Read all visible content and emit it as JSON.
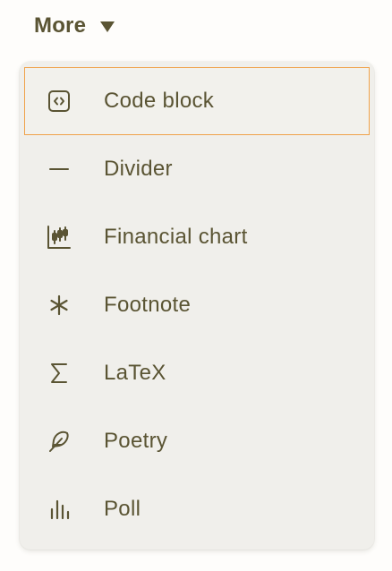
{
  "toggle": {
    "label": "More"
  },
  "menu": {
    "items": [
      {
        "label": "Code block",
        "icon": "code-block-icon",
        "active": true
      },
      {
        "label": "Divider",
        "icon": "divider-icon"
      },
      {
        "label": "Financial chart",
        "icon": "candlestick-chart-icon"
      },
      {
        "label": "Footnote",
        "icon": "asterisk-icon"
      },
      {
        "label": "LaTeX",
        "icon": "sigma-icon"
      },
      {
        "label": "Poetry",
        "icon": "feather-icon"
      },
      {
        "label": "Poll",
        "icon": "bar-chart-icon"
      }
    ]
  },
  "colors": {
    "text": "#5a5433",
    "menu_bg": "#f0efeb",
    "active_border": "#f0a24a"
  }
}
